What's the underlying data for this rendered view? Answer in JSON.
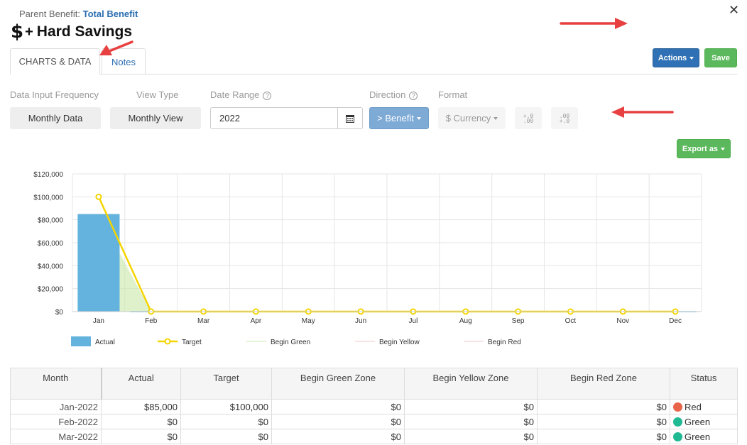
{
  "header": {
    "parent_label": "Parent Benefit:",
    "parent_link": "Total Benefit",
    "title": "Hard Savings",
    "close_glyph": "✕"
  },
  "tabs": [
    {
      "label": "CHARTS & DATA",
      "active": true
    },
    {
      "label": "Notes",
      "active": false
    }
  ],
  "toolbar": {
    "actions_label": "Actions",
    "save_label": "Save",
    "export_label": "Export as"
  },
  "filters": {
    "frequency_label": "Data Input Frequency",
    "frequency_value": "Monthly Data",
    "view_label": "View Type",
    "view_value": "Monthly View",
    "date_label": "Date Range",
    "date_value": "2022",
    "direction_label": "Direction",
    "direction_value": "> Benefit",
    "format_label": "Format",
    "format_value": "$ Currency",
    "dec_increase": [
      "+.0",
      ".00"
    ],
    "dec_decrease": [
      ".00",
      "+.0"
    ]
  },
  "chart_data": {
    "type": "bar",
    "categories": [
      "Jan",
      "Feb",
      "Mar",
      "Apr",
      "May",
      "Jun",
      "Jul",
      "Aug",
      "Sep",
      "Oct",
      "Nov",
      "Dec"
    ],
    "ylim": [
      0,
      120000
    ],
    "yticks": [
      0,
      20000,
      40000,
      60000,
      80000,
      100000,
      120000
    ],
    "ytick_labels": [
      "$0",
      "$20,000",
      "$40,000",
      "$60,000",
      "$80,000",
      "$100,000",
      "$120,000"
    ],
    "grid": true,
    "legend_position": "bottom-left",
    "series": [
      {
        "name": "Actual",
        "type": "bar",
        "color": "#63b3de",
        "values": [
          85000,
          0,
          0,
          0,
          0,
          0,
          0,
          0,
          0,
          0,
          0,
          0
        ]
      },
      {
        "name": "Target",
        "type": "line",
        "color": "#f5d400",
        "values": [
          100000,
          0,
          0,
          0,
          0,
          0,
          0,
          0,
          0,
          0,
          0,
          0
        ]
      },
      {
        "name": "Begin Green",
        "type": "area",
        "color": "#c8e8a8",
        "values": [
          85000,
          0,
          0,
          0,
          0,
          0,
          0,
          0,
          0,
          0,
          0,
          0
        ]
      },
      {
        "name": "Begin Yellow",
        "type": "line",
        "color": "#f0c8c8",
        "values": [
          0,
          0,
          0,
          0,
          0,
          0,
          0,
          0,
          0,
          0,
          0,
          0
        ]
      },
      {
        "name": "Begin Red",
        "type": "line",
        "color": "#f0c8c8",
        "values": [
          0,
          0,
          0,
          0,
          0,
          0,
          0,
          0,
          0,
          0,
          0,
          0
        ]
      }
    ]
  },
  "table": {
    "columns": [
      "Month",
      "Actual",
      "Target",
      "Begin Green Zone",
      "Begin Yellow Zone",
      "Begin Red Zone",
      "Status"
    ],
    "rows": [
      {
        "month": "Jan-2022",
        "actual": "$85,000",
        "target": "$100,000",
        "green": "$0",
        "yellow": "$0",
        "red": "$0",
        "status": "Red",
        "status_color": "#e8654a"
      },
      {
        "month": "Feb-2022",
        "actual": "$0",
        "target": "$0",
        "green": "$0",
        "yellow": "$0",
        "red": "$0",
        "status": "Green",
        "status_color": "#1fb994"
      },
      {
        "month": "Mar-2022",
        "actual": "$0",
        "target": "$0",
        "green": "$0",
        "yellow": "$0",
        "red": "$0",
        "status": "Green",
        "status_color": "#1fb994"
      }
    ]
  },
  "colors": {
    "primary": "#2f71b4",
    "success": "#5cb85c",
    "annotation_arrow": "#e84040"
  }
}
